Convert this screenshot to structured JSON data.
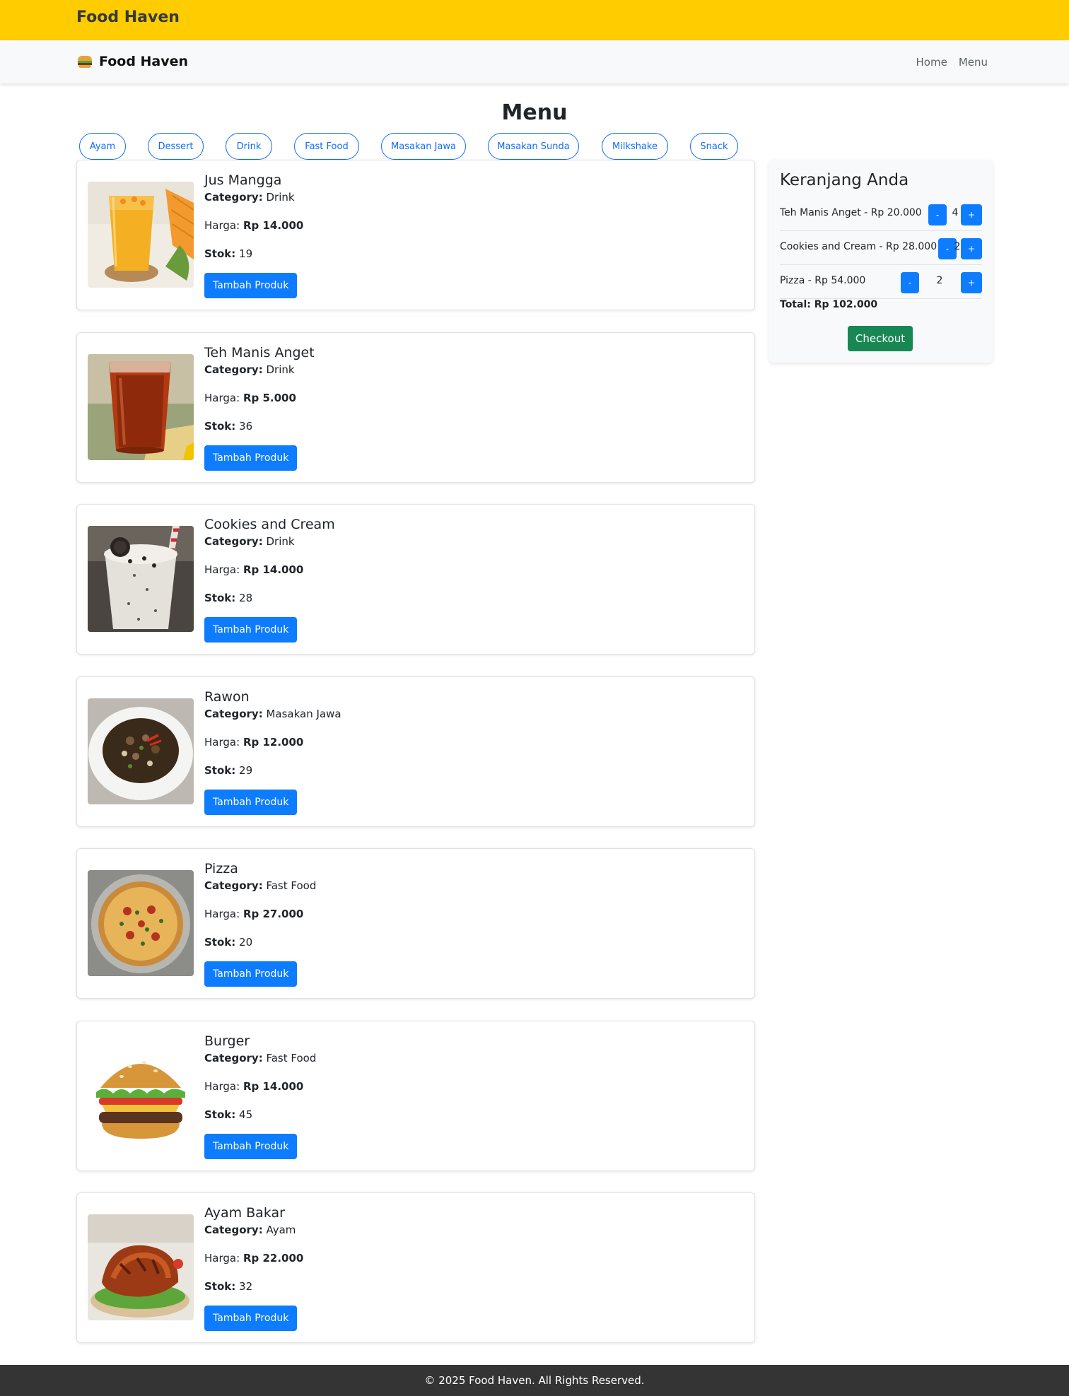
{
  "topbar": {
    "title": "Food Haven"
  },
  "navbar": {
    "brand": "Food Haven",
    "links": [
      "Home",
      "Menu"
    ]
  },
  "page_title": "Menu",
  "categories": [
    "Ayam",
    "Dessert",
    "Drink",
    "Fast Food",
    "Masakan Jawa",
    "Masakan Sunda",
    "Milkshake",
    "Snack"
  ],
  "labels": {
    "category": "Category:",
    "price": "Harga:",
    "stock": "Stok:",
    "add_button": "Tambah Produk"
  },
  "products": [
    {
      "name": "Jus Mangga",
      "category": "Drink",
      "price": "Rp 14.000",
      "stock": "19"
    },
    {
      "name": "Teh Manis Anget",
      "category": "Drink",
      "price": "Rp 5.000",
      "stock": "36"
    },
    {
      "name": "Cookies and Cream",
      "category": "Drink",
      "price": "Rp 14.000",
      "stock": "28"
    },
    {
      "name": "Rawon",
      "category": "Masakan Jawa",
      "price": "Rp 12.000",
      "stock": "29"
    },
    {
      "name": "Pizza",
      "category": "Fast Food",
      "price": "Rp 27.000",
      "stock": "20"
    },
    {
      "name": "Burger",
      "category": "Fast Food",
      "price": "Rp 14.000",
      "stock": "45"
    },
    {
      "name": "Ayam Bakar",
      "category": "Ayam",
      "price": "Rp 22.000",
      "stock": "32"
    }
  ],
  "cart": {
    "title": "Keranjang Anda",
    "items": [
      {
        "text": "Teh Manis Anget - Rp 20.000",
        "qty": "4",
        "minus": "-",
        "plus": "+"
      },
      {
        "text": "Cookies and Cream - Rp 28.000",
        "qty": "2",
        "minus": "-",
        "plus": "+"
      },
      {
        "text": "Pizza - Rp 54.000",
        "qty": "2",
        "minus": "-",
        "plus": "+"
      }
    ],
    "total": "Total: Rp 102.000",
    "checkout_label": "Checkout"
  },
  "footer": {
    "text": "© 2025 Food Haven. All Rights Reserved."
  }
}
